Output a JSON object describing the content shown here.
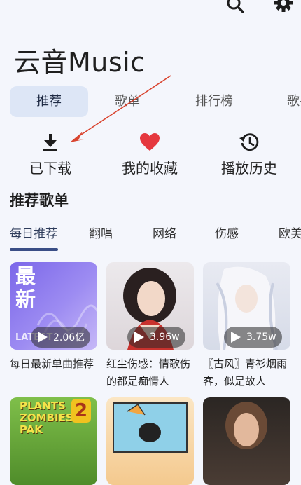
{
  "header": {
    "title": "云音Music",
    "icons": [
      "search-icon",
      "gear-icon"
    ]
  },
  "main_tabs": [
    {
      "label": "推荐",
      "active": true
    },
    {
      "label": "歌单",
      "active": false
    },
    {
      "label": "排行榜",
      "active": false
    },
    {
      "label": "歌手",
      "active": false
    }
  ],
  "quick_actions": [
    {
      "label": "已下载",
      "icon": "download-icon"
    },
    {
      "label": "我的收藏",
      "icon": "heart-icon"
    },
    {
      "label": "播放历史",
      "icon": "history-icon"
    }
  ],
  "section": {
    "title": "推荐歌单"
  },
  "categories": [
    {
      "label": "每日推荐",
      "active": true
    },
    {
      "label": "翻唱",
      "active": false
    },
    {
      "label": "网络",
      "active": false
    },
    {
      "label": "伤感",
      "active": false
    },
    {
      "label": "欧美",
      "active": false
    }
  ],
  "playlists": [
    {
      "title": "每日最新单曲推荐",
      "plays": "2.06亿",
      "cover_text": "最\n新",
      "cover_sub": "LATEST"
    },
    {
      "title": "红尘伤感：情歌伤的都是痴情人",
      "plays": "3.96w"
    },
    {
      "title": "〖古风〗青衫烟雨客，似是故人",
      "plays": "3.75w"
    },
    {
      "title": "",
      "plays": "",
      "cover_text": "PLANTS ZOMBIES PAK"
    },
    {
      "title": "",
      "plays": ""
    },
    {
      "title": "",
      "plays": ""
    }
  ],
  "colors": {
    "background": "#f4f6fc",
    "tab_active_bg": "#dde6f6",
    "heart": "#e5383f",
    "underline": "#3a4e86",
    "annotation_arrow": "#d9442f"
  }
}
